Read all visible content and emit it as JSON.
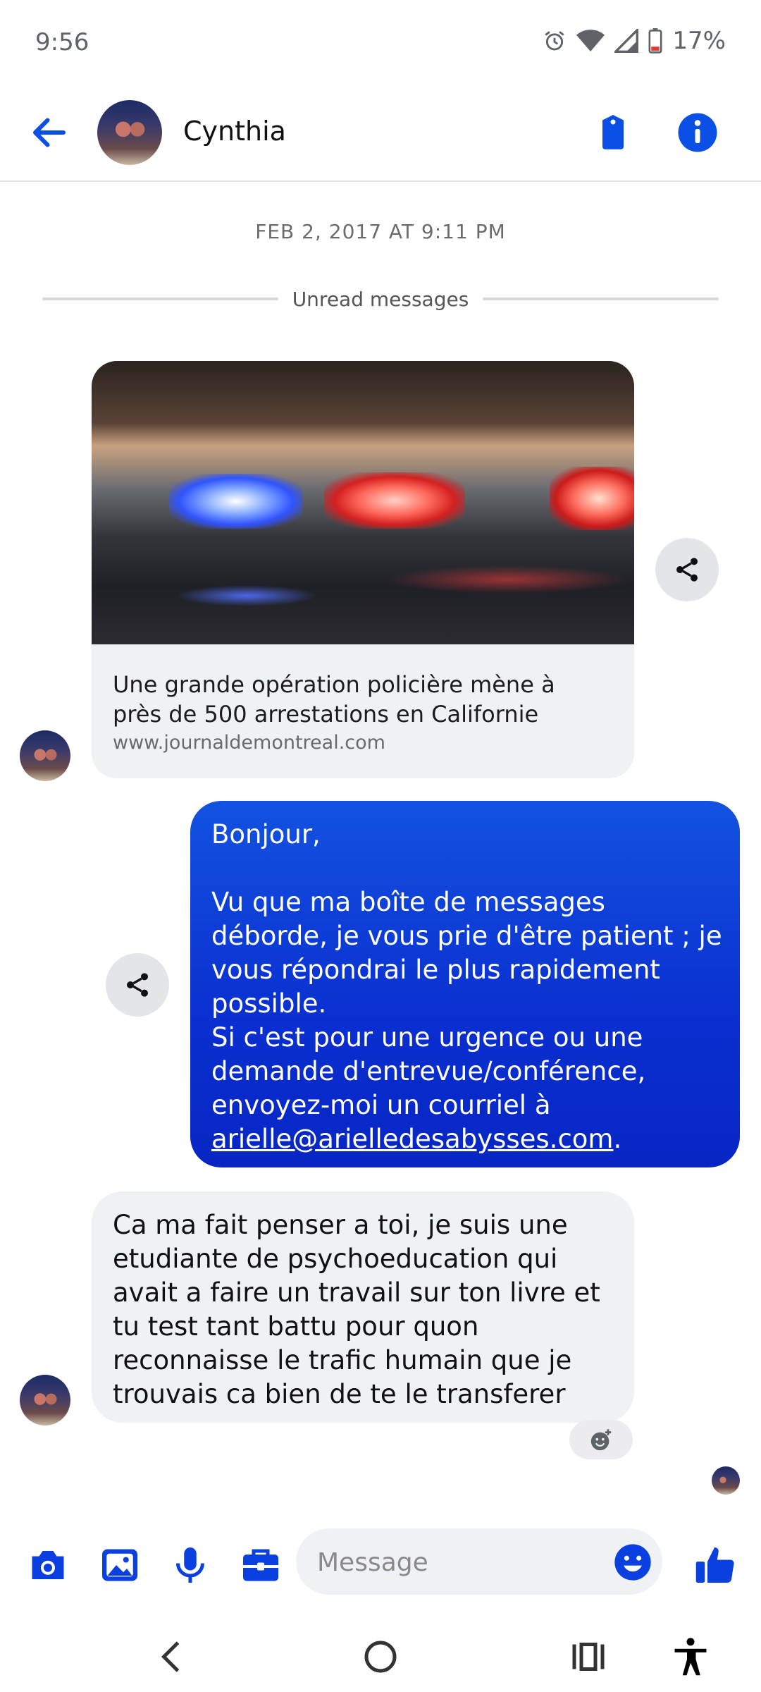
{
  "status_bar": {
    "time": "9:56",
    "battery": "17%"
  },
  "header": {
    "contact_name": "Cynthia"
  },
  "conversation": {
    "date_stamp": "FEB 2, 2017 AT 9:11 PM",
    "unread_label": "Unread messages",
    "link_card": {
      "title": "Une grande opération policière mène à près de 500 arrestations en Californie",
      "domain": "www.journaldemontreal.com"
    },
    "outgoing": {
      "greeting": "Bonjour,",
      "para1": "Vu que ma boîte de messages déborde, je vous prie d'être patient ; je vous répondrai le plus rapidement possible.",
      "para2_prefix": "Si c'est pour une urgence ou une demande d'entrevue/conférence, envoyez-moi un courriel à ",
      "email": "arielle@arielledesabysses.com",
      "para2_suffix": "."
    },
    "incoming_text": "Ca ma fait penser a toi, je suis une etudiante de psychoeducation qui avait a faire un travail sur ton livre et tu test tant battu pour quon reconnaisse le trafic humain que je trouvais ca bien de te le transferer"
  },
  "composer": {
    "placeholder": "Message"
  },
  "colors": {
    "accent": "#0a4fe6",
    "bubble_out": "#0a2fd0",
    "bubble_in": "#f0f1f4"
  }
}
